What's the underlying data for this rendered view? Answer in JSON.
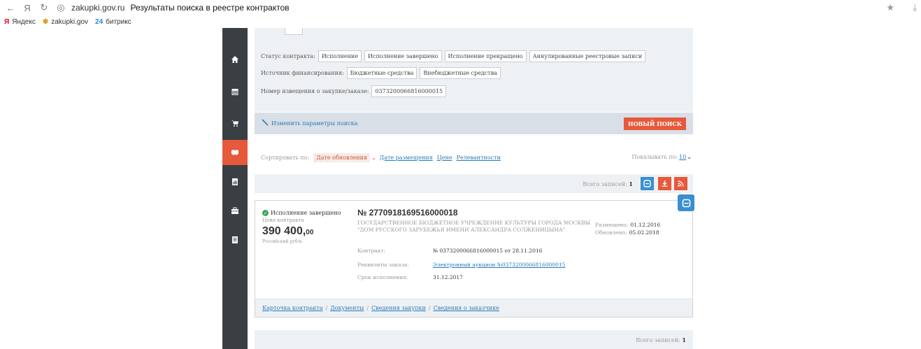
{
  "browser": {
    "host": "zakupki.gov.ru",
    "title": "Результаты поиска в реестре контрактов",
    "bookmarks": [
      {
        "icon": "Я",
        "label": "Яндекс",
        "color": "#e30611"
      },
      {
        "icon": "✾",
        "label": "zakupki.gov",
        "color": "#d99a1e"
      },
      {
        "icon": "24",
        "label": "битрикс",
        "color": "#1f8fd6"
      }
    ]
  },
  "filters": {
    "status_label": "Статус контракта:",
    "status_chips": [
      "Исполнение",
      "Исполнение завершено",
      "Исполнение прекращено",
      "Аннулированные реестровые записи"
    ],
    "funding_label": "Источник финансирования:",
    "funding_chips": [
      "Бюджетные средства",
      "Внебюджетные средства"
    ],
    "notice_label": "Номер извещения о закупке/заказе:",
    "notice_value": "0373200066816000015"
  },
  "modify": {
    "link": "Изменить параметры поиска",
    "new_search": "НОВЫЙ ПОИСК"
  },
  "sort": {
    "label": "Сортировать по:",
    "active": "Дате обновления",
    "options": [
      "Дате размещения",
      "Цене",
      "Релевантности"
    ],
    "show_per_label": "Показывать по:",
    "show_per_value": "10"
  },
  "totals": {
    "label": "Всего записей:",
    "count": "1"
  },
  "result": {
    "status": "Исполнение завершено",
    "price_label": "Цена контракта",
    "price_main": "390 400,",
    "price_cents": "00",
    "currency": "Российский рубль",
    "number": "№ 2770918169516000018",
    "customer": "ГОСУДАРСТВЕННОЕ БЮДЖЕТНОЕ УЧРЕЖДЕНИЕ КУЛЬТУРЫ ГОРОДА МОСКВЫ \"ДОМ РУССКОГО ЗАРУБЕЖЬЯ ИМЕНИ АЛЕКСАНДРА СОЛЖЕНИЦЫНА\"",
    "placed_label": "Размещено:",
    "placed_value": "01.12.2016",
    "updated_label": "Обновлено:",
    "updated_value": "05.02.2018",
    "contract_label": "Контракт:",
    "contract_value": "№ 0373200066816000015 от 28.11.2016",
    "order_label": "Реквизиты заказа:",
    "order_value": "Электронный аукцион №0373200066816000015",
    "deadline_label": "Срок исполнения:",
    "deadline_value": "31.12.2017",
    "footer_links": [
      "Карточка контракта",
      "Документы",
      "Сведения закупки",
      "Сведения о заказчике"
    ]
  },
  "colors": {
    "accent": "#e6593a",
    "link": "#2a7ab8",
    "sidebar": "#3a3f44",
    "print": "#3a8fd0"
  }
}
